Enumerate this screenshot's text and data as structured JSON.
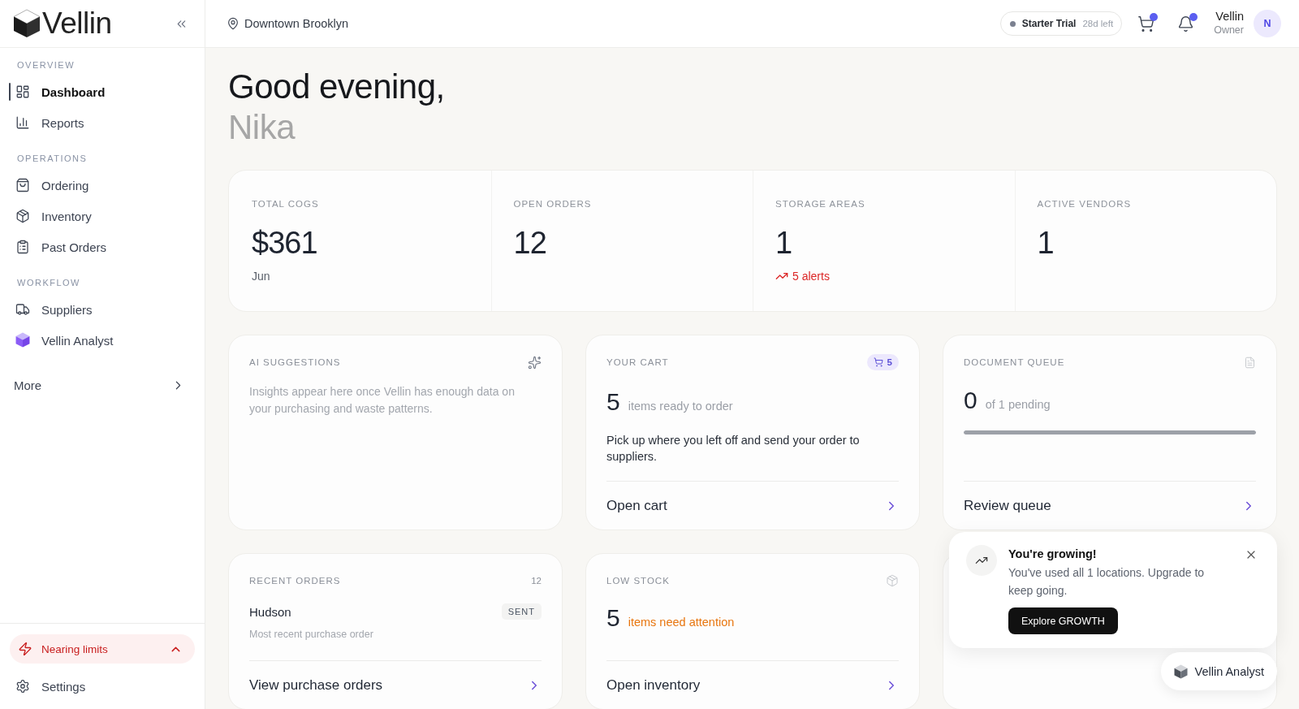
{
  "sidebar": {
    "logo": "Vellin",
    "sections": [
      {
        "heading": "OVERVIEW",
        "items": [
          {
            "label": "Dashboard",
            "selected": true
          },
          {
            "label": "Reports",
            "selected": false
          }
        ]
      },
      {
        "heading": "OPERATIONS",
        "items": [
          {
            "label": "Ordering",
            "selected": false
          },
          {
            "label": "Inventory",
            "selected": false
          },
          {
            "label": "Past Orders",
            "selected": false
          }
        ]
      },
      {
        "heading": "WORKFLOW",
        "items": [
          {
            "label": "Suppliers",
            "selected": false
          },
          {
            "label": "Vellin Analyst",
            "selected": false
          }
        ]
      }
    ],
    "more": "More",
    "limits": "Nearing limits",
    "settings": "Settings"
  },
  "header": {
    "location": "Downtown Brooklyn",
    "plan": "Starter Trial",
    "trial_left": "28d left",
    "cart_unread": true,
    "notifications_unread": true,
    "user_name": "Vellin",
    "user_role": "Owner",
    "avatar_initial": "N"
  },
  "greeting": {
    "salutation": "Good evening,",
    "name": "Nika"
  },
  "stats": [
    {
      "label": "TOTAL COGS",
      "value": "$361",
      "note": "Jun"
    },
    {
      "label": "OPEN ORDERS",
      "value": "12"
    },
    {
      "label": "STORAGE AREAS",
      "value": "1",
      "alert": "5 alerts"
    },
    {
      "label": "ACTIVE VENDORS",
      "value": "1"
    }
  ],
  "cards": [
    {
      "kind": "suggestions",
      "title": "AI SUGGESTIONS",
      "text": "Insights appear here once Vellin has enough data on your purchasing and waste patterns."
    },
    {
      "kind": "cart",
      "title": "YOUR CART",
      "badge": "5",
      "count": "5",
      "count_label": "items ready to order",
      "text": "Pick up where you left off and send your order to suppliers.",
      "action": "Open cart"
    },
    {
      "kind": "queue",
      "title": "DOCUMENT QUEUE",
      "count": "0",
      "count_label": "of 1 pending",
      "level": 1,
      "action": "Review queue"
    },
    {
      "kind": "orders",
      "title": "RECENT ORDERS",
      "badge": "12",
      "vendor": "Hudson",
      "status": "SENT",
      "note": "Most recent purchase order",
      "action": "View purchase orders"
    },
    {
      "kind": "stock",
      "title": "LOW STOCK",
      "count": "5",
      "count_label": "items need attention",
      "action": "Open inventory"
    }
  ],
  "upgrade_popup": {
    "title": "You're growing!",
    "text": "You've used all 1 locations. Upgrade to keep going.",
    "button": "Explore GROWTH"
  },
  "analyst_button": {
    "label": "Vellin Analyst"
  }
}
